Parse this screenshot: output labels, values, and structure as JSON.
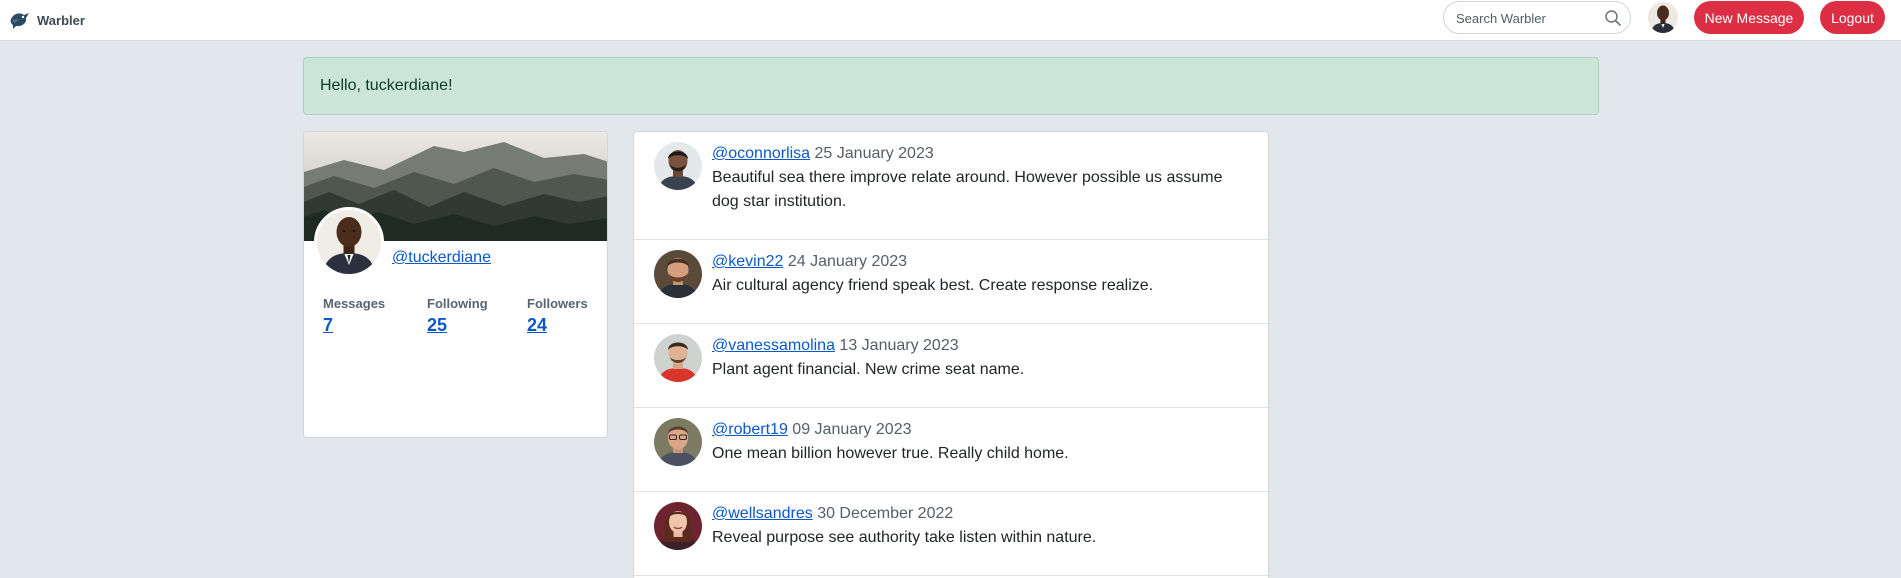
{
  "app": {
    "brand": "Warbler",
    "logo_icon": "warbler-bird-icon"
  },
  "search": {
    "placeholder": "Search Warbler",
    "icon": "search-icon"
  },
  "nav": {
    "new_message_label": "New Message",
    "logout_label": "Logout"
  },
  "alert": {
    "text": "Hello, tuckerdiane!"
  },
  "profile": {
    "username": "@tuckerdiane",
    "stats": [
      {
        "label": "Messages",
        "value": "7"
      },
      {
        "label": "Following",
        "value": "25"
      },
      {
        "label": "Followers",
        "value": "24"
      }
    ]
  },
  "messages": [
    {
      "user": "@oconnorlisa",
      "date": "25 January 2023",
      "text": "Beautiful sea there improve relate around. However possible us assume dog star institution."
    },
    {
      "user": "@kevin22",
      "date": "24 January 2023",
      "text": "Air cultural agency friend speak best. Create response realize."
    },
    {
      "user": "@vanessamolina",
      "date": "13 January 2023",
      "text": "Plant agent financial. New crime seat name."
    },
    {
      "user": "@robert19",
      "date": "09 January 2023",
      "text": "One mean billion however true. Really child home."
    },
    {
      "user": "@wellsandres",
      "date": "30 December 2022",
      "text": "Reveal purpose see authority take listen within nature."
    }
  ],
  "colors": {
    "accent_red": "#dc2f44",
    "link_blue": "#0a58ca",
    "alert_bg": "#cbe5d9",
    "page_bg": "#e1e7ea"
  }
}
